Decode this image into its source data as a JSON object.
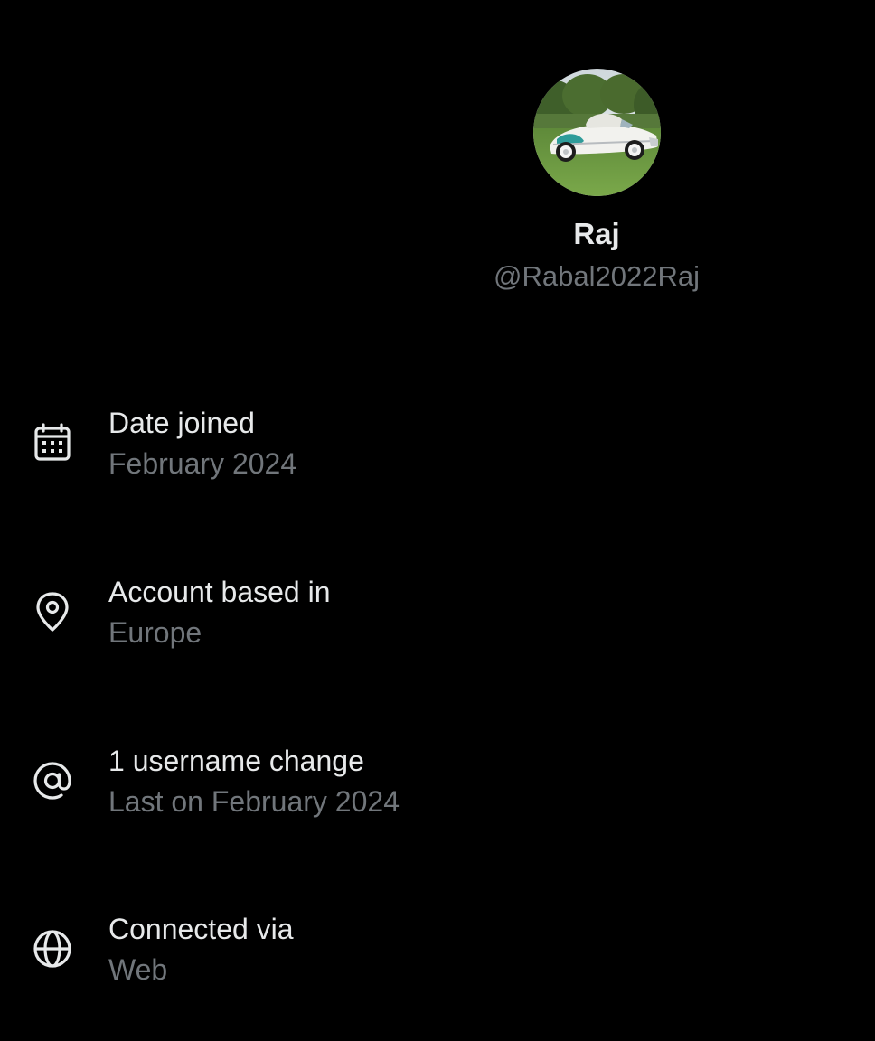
{
  "profile": {
    "display_name": "Raj",
    "handle": "@Rabal2022Raj",
    "avatar_description": "vintage white sports car on grass"
  },
  "details": [
    {
      "icon": "calendar-icon",
      "title": "Date joined",
      "value": "February 2024"
    },
    {
      "icon": "location-pin-icon",
      "title": "Account based in",
      "value": "Europe"
    },
    {
      "icon": "at-sign-icon",
      "title": "1 username change",
      "value": "Last on February 2024"
    },
    {
      "icon": "globe-icon",
      "title": "Connected via",
      "value": "Web"
    }
  ],
  "colors": {
    "background": "#000000",
    "primary_text": "#e7e9ea",
    "secondary_text": "#71767b"
  }
}
